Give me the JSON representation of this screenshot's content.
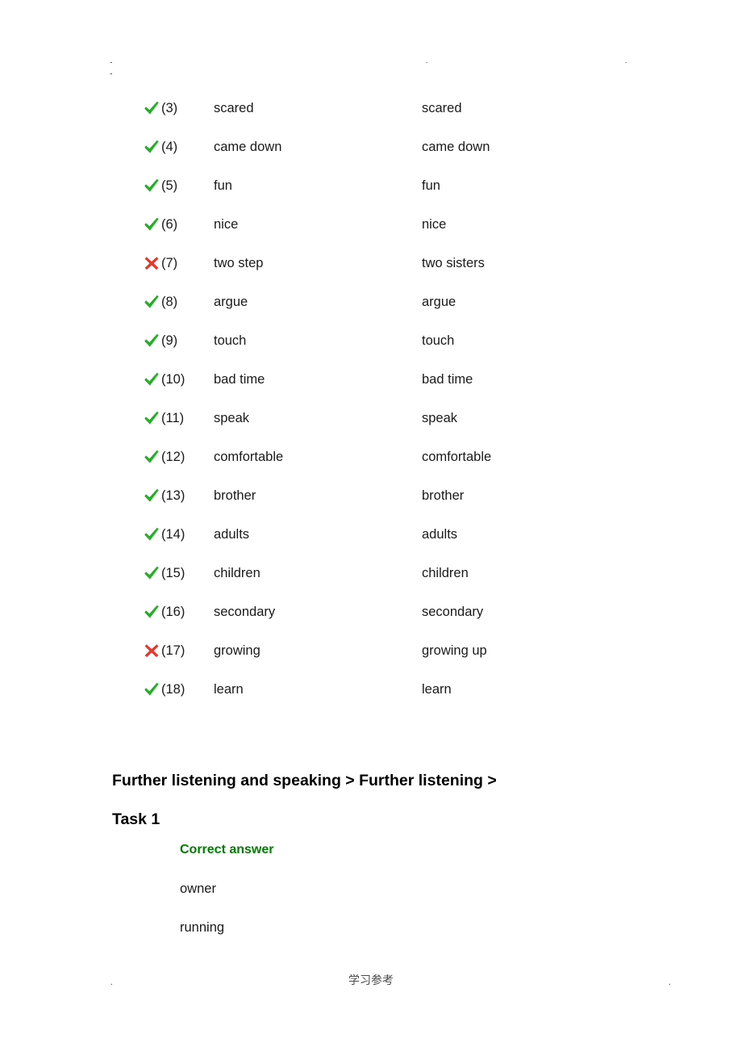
{
  "page": {
    "header_artifacts": [
      "..",
      "..",
      ".",
      "."
    ],
    "footer_text": "学习参考",
    "footer_dot_left": ".",
    "footer_dot_right": "."
  },
  "colors": {
    "correct_mark": "#22b024",
    "incorrect_mark": "#e8362a",
    "correct_answer_label": "#008000",
    "body_text": "#1a1a1a",
    "heading_text": "#000000",
    "page_background": "#ffffff"
  },
  "answer_list": {
    "rows": [
      {
        "status": "correct",
        "status_icon": "check-icon",
        "number": "(3)",
        "your_answer": "scared",
        "correct_answer": "scared"
      },
      {
        "status": "correct",
        "status_icon": "check-icon",
        "number": "(4)",
        "your_answer": "came down",
        "correct_answer": "came down"
      },
      {
        "status": "correct",
        "status_icon": "check-icon",
        "number": "(5)",
        "your_answer": "fun",
        "correct_answer": "fun"
      },
      {
        "status": "correct",
        "status_icon": "check-icon",
        "number": "(6)",
        "your_answer": "nice",
        "correct_answer": "nice"
      },
      {
        "status": "incorrect",
        "status_icon": "cross-icon",
        "number": "(7)",
        "your_answer": "two step",
        "correct_answer": "two sisters"
      },
      {
        "status": "correct",
        "status_icon": "check-icon",
        "number": "(8)",
        "your_answer": "argue",
        "correct_answer": "argue"
      },
      {
        "status": "correct",
        "status_icon": "check-icon",
        "number": "(9)",
        "your_answer": "touch",
        "correct_answer": "touch"
      },
      {
        "status": "correct",
        "status_icon": "check-icon",
        "number": "(10)",
        "your_answer": "bad time",
        "correct_answer": "bad time"
      },
      {
        "status": "correct",
        "status_icon": "check-icon",
        "number": "(11)",
        "your_answer": "speak",
        "correct_answer": "speak"
      },
      {
        "status": "correct",
        "status_icon": "check-icon",
        "number": "(12)",
        "your_answer": "comfortable",
        "correct_answer": "comfortable"
      },
      {
        "status": "correct",
        "status_icon": "check-icon",
        "number": "(13)",
        "your_answer": "brother",
        "correct_answer": "brother"
      },
      {
        "status": "correct",
        "status_icon": "check-icon",
        "number": "(14)",
        "your_answer": "adults",
        "correct_answer": "adults"
      },
      {
        "status": "correct",
        "status_icon": "check-icon",
        "number": "(15)",
        "your_answer": "children",
        "correct_answer": "children"
      },
      {
        "status": "correct",
        "status_icon": "check-icon",
        "number": "(16)",
        "your_answer": "secondary",
        "correct_answer": "secondary"
      },
      {
        "status": "incorrect",
        "status_icon": "cross-icon",
        "number": "(17)",
        "your_answer": "growing",
        "correct_answer": "growing up"
      },
      {
        "status": "correct",
        "status_icon": "check-icon",
        "number": "(18)",
        "your_answer": "learn",
        "correct_answer": "learn"
      }
    ]
  },
  "section": {
    "breadcrumb_line": "Further listening and speaking > Further listening >",
    "task_line": "Task 1"
  },
  "correct_answer_block": {
    "label": "Correct answer",
    "items": [
      "owner",
      "running"
    ]
  }
}
